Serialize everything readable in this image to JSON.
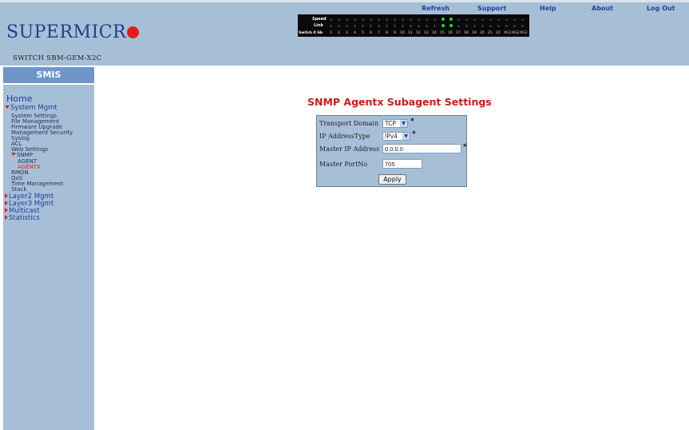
{
  "header": {
    "logo_text": "SUPERMICR",
    "switch_name": "SWITCH SBM-GEM-X2C",
    "links": [
      "Refresh",
      "Support",
      "Help",
      "About",
      "Log Out"
    ]
  },
  "led_panel": {
    "row_labels": [
      "Speed",
      "Link",
      "Switch 0 Gb"
    ],
    "ports": [
      "1",
      "2",
      "3",
      "4",
      "5",
      "6",
      "7",
      "8",
      "9",
      "10",
      "11",
      "12",
      "13",
      "14",
      "15",
      "16",
      "17",
      "18",
      "19",
      "20",
      "21",
      "22",
      "XG1",
      "XG2",
      "XG3"
    ],
    "active_ports": [
      "15",
      "16"
    ],
    "active_color": "#22dd22"
  },
  "sidebar": {
    "title": "SMIS",
    "home": "Home",
    "system_mgmt": "System Mgmt",
    "items": [
      "System Settings",
      "File Management",
      "Firmware Upgrade",
      "Management Security",
      "Syslog",
      "ACL",
      "Web Settings"
    ],
    "snmp": "SNMP",
    "snmp_items": [
      "AGENT",
      "AGENTX"
    ],
    "items2": [
      "RMON",
      "QoS",
      "Time Management",
      "Stack"
    ],
    "sections": [
      "Layer2 Mgmt",
      "Layer3 Mgmt",
      "Multicast",
      "Statistics"
    ],
    "active_color": "#e02020"
  },
  "main": {
    "title": "SNMP Agentx Subagent Settings",
    "form": {
      "transport_domain_label": "Transport Domain",
      "transport_domain_value": "TCP",
      "ip_address_type_label": "IP AddressType",
      "ip_address_type_value": "IPv4",
      "master_ip_label": "Master IP Address",
      "master_ip_value": "0.0.0.0",
      "master_port_label": "Master PortNo",
      "master_port_value": "705",
      "required_marker": "*",
      "apply_label": "Apply"
    }
  },
  "colors": {
    "header_bg": "#a7bfd6",
    "title_red": "#d01a1a",
    "link_blue": "#2040a0"
  }
}
